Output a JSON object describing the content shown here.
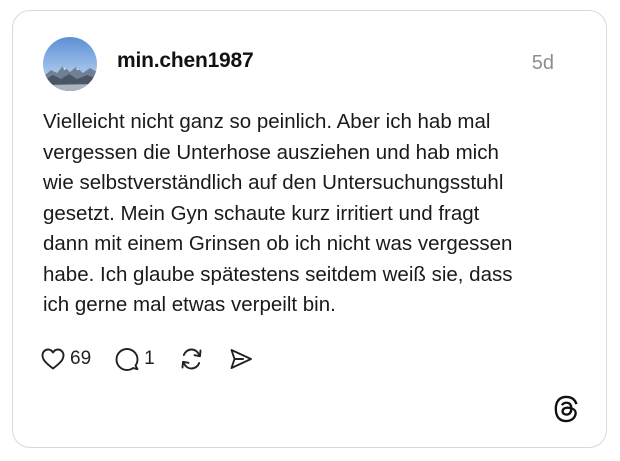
{
  "post": {
    "author": {
      "username": "min.chen1987",
      "avatar_icon": "mountain-landscape-avatar"
    },
    "timestamp": "5d",
    "text": "Vielleicht nicht ganz so peinlich. Aber ich hab mal\nvergessen die Unterhose ausziehen und hab mich\nwie selbstverständlich auf den Untersuchungsstuhl\ngesetzt. Mein Gyn schaute kurz irritiert und fragt\ndann mit einem Grinsen ob ich nicht was vergessen\nhabe. Ich glaube spätestens seitdem weiß sie, dass\nich gerne mal etwas verpeilt bin.",
    "actions": {
      "likes": "69",
      "replies": "1",
      "like_icon": "heart-icon",
      "reply_icon": "comment-bubble-icon",
      "repost_icon": "repost-icon",
      "share_icon": "send-icon"
    }
  },
  "branding": {
    "logo_icon": "threads-logo-icon"
  },
  "colors": {
    "text": "#111111",
    "muted": "#8e8e8e",
    "border": "#d9d9d9",
    "background": "#ffffff"
  }
}
